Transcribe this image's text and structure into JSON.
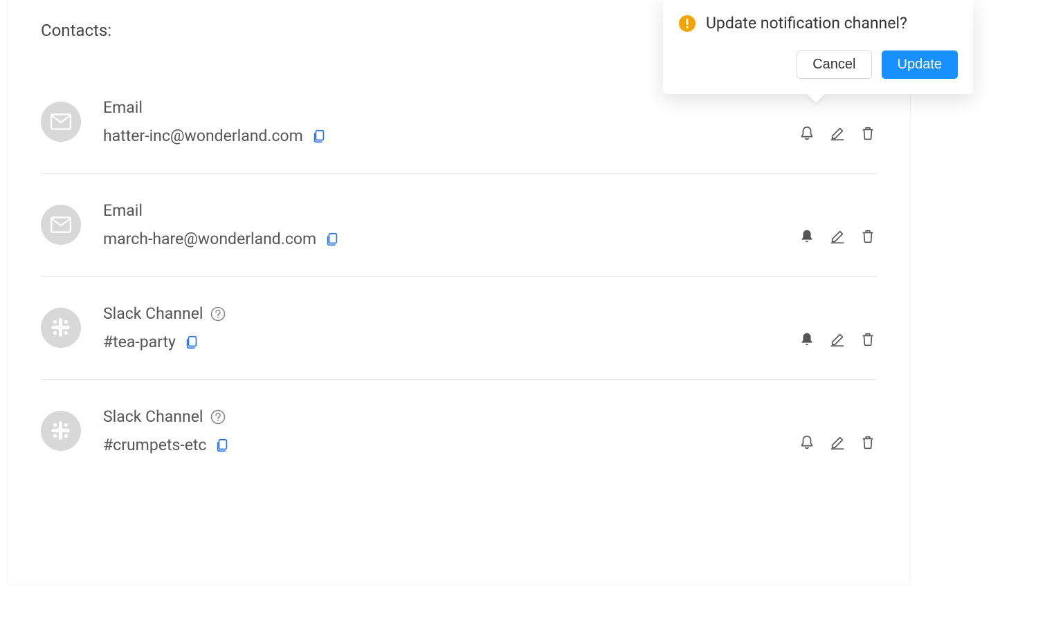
{
  "header": {
    "contacts_label": "Contacts:"
  },
  "popover": {
    "title": "Update notification channel?",
    "cancel_label": "Cancel",
    "update_label": "Update"
  },
  "contacts": [
    {
      "type": "Email",
      "value": "hatter-inc@wonderland.com",
      "help": false,
      "bell_filled": false
    },
    {
      "type": "Email",
      "value": "march-hare@wonderland.com",
      "help": false,
      "bell_filled": true
    },
    {
      "type": "Slack Channel",
      "value": "#tea-party",
      "help": true,
      "bell_filled": true
    },
    {
      "type": "Slack Channel",
      "value": "#crumpets-etc",
      "help": true,
      "bell_filled": false
    }
  ]
}
